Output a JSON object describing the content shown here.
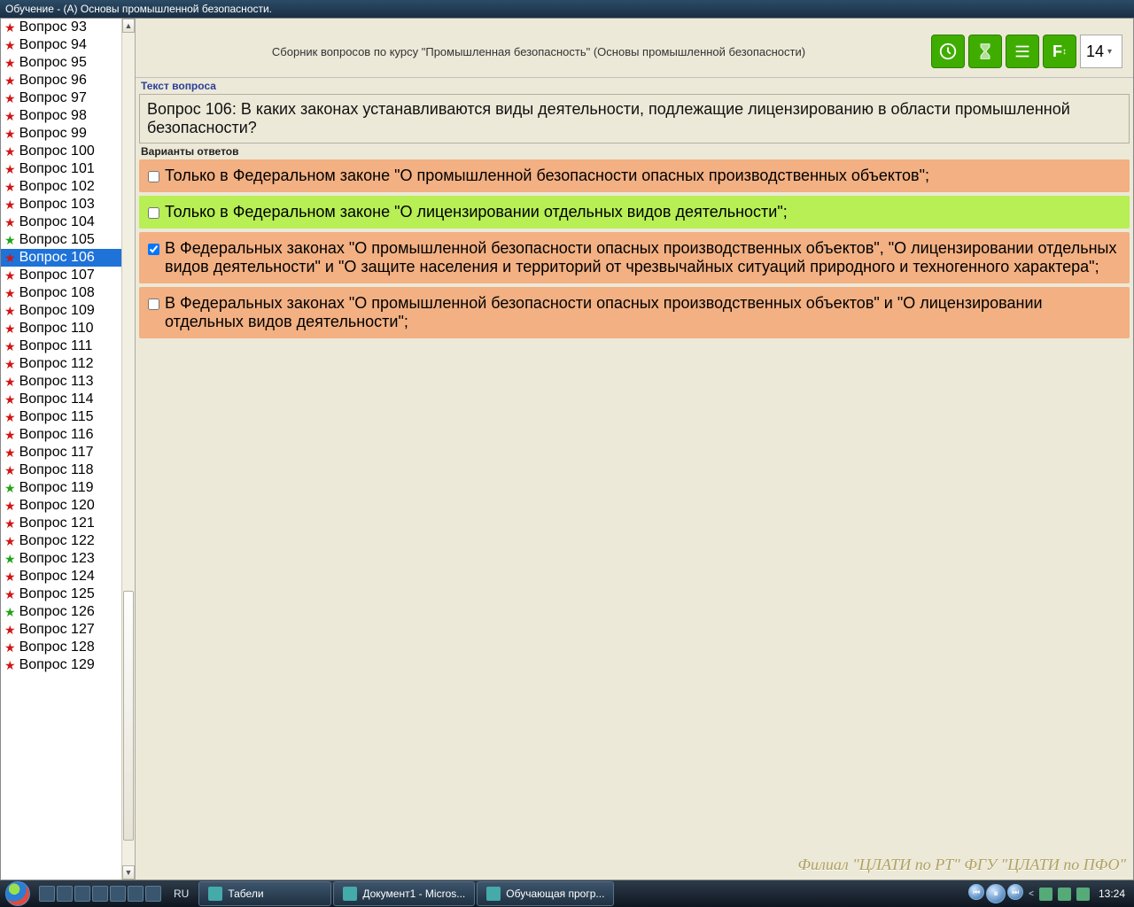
{
  "window": {
    "title": "Обучение - (А) Основы промышленной безопасности."
  },
  "sidebar": {
    "items": [
      {
        "label": "Вопрос 93",
        "star": "red"
      },
      {
        "label": "Вопрос 94",
        "star": "red"
      },
      {
        "label": "Вопрос 95",
        "star": "red"
      },
      {
        "label": "Вопрос 96",
        "star": "red"
      },
      {
        "label": "Вопрос 97",
        "star": "red"
      },
      {
        "label": "Вопрос 98",
        "star": "red"
      },
      {
        "label": "Вопрос 99",
        "star": "red"
      },
      {
        "label": "Вопрос 100",
        "star": "red"
      },
      {
        "label": "Вопрос 101",
        "star": "red"
      },
      {
        "label": "Вопрос 102",
        "star": "red"
      },
      {
        "label": "Вопрос 103",
        "star": "red"
      },
      {
        "label": "Вопрос 104",
        "star": "red"
      },
      {
        "label": "Вопрос 105",
        "star": "green"
      },
      {
        "label": "Вопрос 106",
        "star": "red",
        "selected": true
      },
      {
        "label": "Вопрос 107",
        "star": "red"
      },
      {
        "label": "Вопрос 108",
        "star": "red"
      },
      {
        "label": "Вопрос 109",
        "star": "red"
      },
      {
        "label": "Вопрос 110",
        "star": "red"
      },
      {
        "label": "Вопрос 111",
        "star": "red"
      },
      {
        "label": "Вопрос 112",
        "star": "red"
      },
      {
        "label": "Вопрос 113",
        "star": "red"
      },
      {
        "label": "Вопрос 114",
        "star": "red"
      },
      {
        "label": "Вопрос 115",
        "star": "red"
      },
      {
        "label": "Вопрос 116",
        "star": "red"
      },
      {
        "label": "Вопрос 117",
        "star": "red"
      },
      {
        "label": "Вопрос 118",
        "star": "red"
      },
      {
        "label": "Вопрос 119",
        "star": "green"
      },
      {
        "label": "Вопрос 120",
        "star": "red"
      },
      {
        "label": "Вопрос 121",
        "star": "red"
      },
      {
        "label": "Вопрос 122",
        "star": "red"
      },
      {
        "label": "Вопрос 123",
        "star": "green"
      },
      {
        "label": "Вопрос 124",
        "star": "red"
      },
      {
        "label": "Вопрос 125",
        "star": "red"
      },
      {
        "label": "Вопрос 126",
        "star": "green"
      },
      {
        "label": "Вопрос 127",
        "star": "red"
      },
      {
        "label": "Вопрос 128",
        "star": "red"
      },
      {
        "label": "Вопрос 129",
        "star": "red"
      }
    ]
  },
  "header": {
    "title": "Сборник вопросов по курсу \"Промышленная безопасность\" (Основы промышленной безопасности)",
    "font_size_value": "14"
  },
  "labels": {
    "question_section": "Текст вопроса",
    "answers_section": "Варианты ответов"
  },
  "question": {
    "text": "Вопрос 106: В каких законах устанавливаются виды деятельности, подлежащие лицензированию в области промышленной безопасности?"
  },
  "answers": [
    {
      "text": "Только в Федеральном законе \"О промышленной безопасности опасных производственных объектов\";",
      "checked": false,
      "color": "orange"
    },
    {
      "text": "Только в Федеральном законе \"О лицензировании отдельных видов деятельности\";",
      "checked": false,
      "color": "green"
    },
    {
      "text": "В Федеральных законах \"О промышленной безопасности опасных производственных объектов\", \"О лицензировании отдельных видов деятельности\" и \"О защите населения и территорий от чрезвычайных ситуаций природного и техногенного характера\";",
      "checked": true,
      "color": "orange"
    },
    {
      "text": "В Федеральных законах \"О промышленной безопасности опасных производственных объектов\" и \"О лицензировании отдельных видов деятельности\";",
      "checked": false,
      "color": "orange"
    }
  ],
  "watermark": "Филиал \"ЦЛАТИ по РТ\" ФГУ \"ЦЛАТИ по ПФО\"",
  "taskbar": {
    "lang": "RU",
    "items": [
      {
        "label": "Табели"
      },
      {
        "label": "Документ1 - Micros..."
      },
      {
        "label": "Обучающая прогр..."
      }
    ],
    "clock": "13:24"
  }
}
